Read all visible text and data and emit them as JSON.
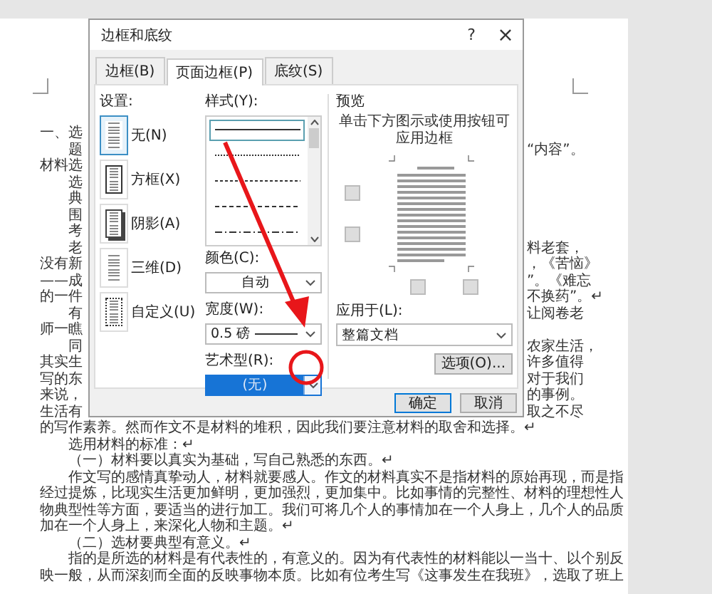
{
  "document": {
    "lines": [
      {
        "text": "一、选",
        "indented": false,
        "kind": "split"
      },
      {
        "text": "题",
        "indented": true,
        "kind": "split",
        "right": "“内容”。"
      },
      {
        "text": "材料选",
        "indented": false,
        "kind": "split"
      },
      {
        "text": "选",
        "indented": true,
        "kind": "split"
      },
      {
        "text": "典",
        "indented": true,
        "kind": "split"
      },
      {
        "text": "围",
        "indented": true,
        "kind": "split"
      },
      {
        "text": "考",
        "indented": true,
        "kind": "split"
      },
      {
        "text": "老",
        "indented": true,
        "kind": "split",
        "right": "料老套，"
      },
      {
        "text": "没有新",
        "indented": false,
        "kind": "split",
        "right": "，《苦恼》"
      },
      {
        "text": "——成",
        "indented": false,
        "kind": "split",
        "right": "”。《难忘"
      },
      {
        "text": "的一件",
        "indented": false,
        "kind": "split",
        "right": "不换药”。↵"
      },
      {
        "text": "有",
        "indented": true,
        "kind": "split",
        "right": "让阅卷老"
      },
      {
        "text": "师一瞧",
        "indented": false,
        "kind": "split"
      },
      {
        "text": "同",
        "indented": true,
        "kind": "split",
        "right": "农家生活，"
      },
      {
        "text": "其实生",
        "indented": false,
        "kind": "split",
        "right": "许多值得"
      },
      {
        "text": "写的东",
        "indented": false,
        "kind": "split",
        "right": "对于我们"
      },
      {
        "text": "来说，",
        "indented": false,
        "kind": "split",
        "right": "的事例。"
      },
      {
        "text": "生活有",
        "indented": false,
        "kind": "split",
        "right": "取之不尽"
      },
      {
        "text": "的写作素养。然而作文不是材料的堆积，因此我们要注意材料的取舍和选择。↵",
        "indented": false,
        "kind": "full"
      },
      {
        "text": "选用材料的标准：↵",
        "indented": true,
        "kind": "full"
      },
      {
        "text": "（一）材料要以真实为基础，写自己熟悉的东西。↵",
        "indented": true,
        "kind": "full"
      },
      {
        "text": "作文写的感情真挚动人，材料就要感人。作文的材料真实不是指材料的原始再现，而是指",
        "indented": true,
        "kind": "full"
      },
      {
        "text": "经过提炼，比现实生活更加鲜明，更加强烈，更加集中。比如事情的完整性、材料的理想性人",
        "indented": false,
        "kind": "full"
      },
      {
        "text": "物典型性等方面，要适当的进行加工。我们可将几个人的事情加在一个人身上，几个人的品质",
        "indented": false,
        "kind": "full"
      },
      {
        "text": "加在一个人身上，来深化人物和主题。↵",
        "indented": false,
        "kind": "full"
      },
      {
        "text": "（二）选材要典型有意义。↵",
        "indented": true,
        "kind": "full"
      },
      {
        "text": "指的是所选的材料是有代表性的，有意义的。因为有代表性的材料能以一当十、以个别反",
        "indented": true,
        "kind": "full"
      },
      {
        "text": "映一般，从而深刻而全面的反映事物本质。比如有位考生写《这事发生在我班》，选取了班上",
        "indented": false,
        "kind": "full"
      }
    ]
  },
  "dialog": {
    "title": "边框和底纹",
    "help": "?",
    "close": "×",
    "tabs": [
      {
        "label": "边框(B)",
        "selected": false
      },
      {
        "label": "页面边框(P)",
        "selected": true
      },
      {
        "label": "底纹(S)",
        "selected": false
      }
    ],
    "setting": {
      "label": "设置:",
      "options": [
        {
          "label": "无(N)",
          "kind": "none",
          "selected": true
        },
        {
          "label": "方框(X)",
          "kind": "box",
          "selected": false
        },
        {
          "label": "阴影(A)",
          "kind": "shadow",
          "selected": false
        },
        {
          "label": "三维(D)",
          "kind": "raised",
          "selected": false
        },
        {
          "label": "自定义(U)",
          "kind": "custom",
          "selected": false
        }
      ]
    },
    "style": {
      "label": "样式(Y):",
      "items": [
        {
          "kind": "solid",
          "selected": true
        },
        {
          "kind": "dotted",
          "selected": false
        },
        {
          "kind": "fine-dashed",
          "selected": false
        },
        {
          "kind": "dashed",
          "selected": false
        },
        {
          "kind": "dash-dot",
          "selected": false
        }
      ]
    },
    "color": {
      "label": "颜色(C):",
      "value": "自动"
    },
    "width": {
      "label": "宽度(W):",
      "value": "0.5 磅"
    },
    "art": {
      "label": "艺术型(R):",
      "value": "(无)"
    },
    "preview": {
      "label": "预览",
      "hint": "单击下方图示或使用按钮可应用边框"
    },
    "apply_to": {
      "label": "应用于(L):",
      "value": "整篇文档"
    },
    "options_button": "选项(O)...",
    "buttons": [
      {
        "label": "确定",
        "default": true
      },
      {
        "label": "取消",
        "default": false
      }
    ]
  }
}
